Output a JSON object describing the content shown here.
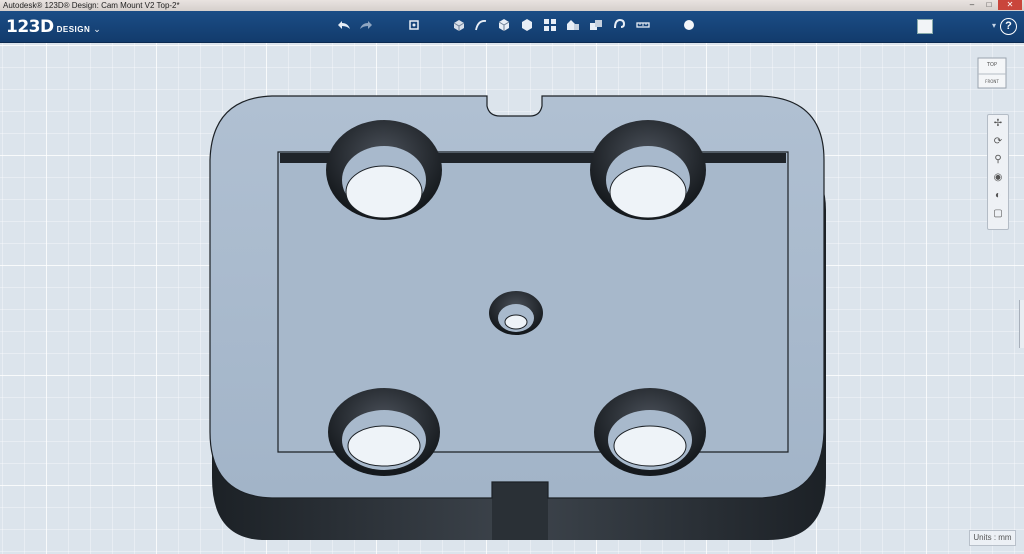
{
  "window": {
    "title": "Autodesk® 123D® Design: Cam Mount V2 Top-2*"
  },
  "app": {
    "logo_main": "123D",
    "logo_sub": "DESIGN"
  },
  "viewcube": {
    "top_label": "TOP",
    "front_label": "FRONT"
  },
  "status": {
    "units": "Units : mm"
  },
  "help": {
    "label": "?"
  },
  "toolbar": {
    "icons": [
      "undo-icon",
      "redo-icon",
      "transform-icon",
      "primitives-icon",
      "sketch-icon",
      "construct-icon",
      "modify-icon",
      "pattern-icon",
      "grouping-icon",
      "combine-icon",
      "snap-icon",
      "measure-icon",
      "material-icon"
    ]
  },
  "colors": {
    "toolbar": "#16457a",
    "part_face": "#a9bacd",
    "part_side": "#2b3036",
    "grid": "#dce4ec"
  }
}
